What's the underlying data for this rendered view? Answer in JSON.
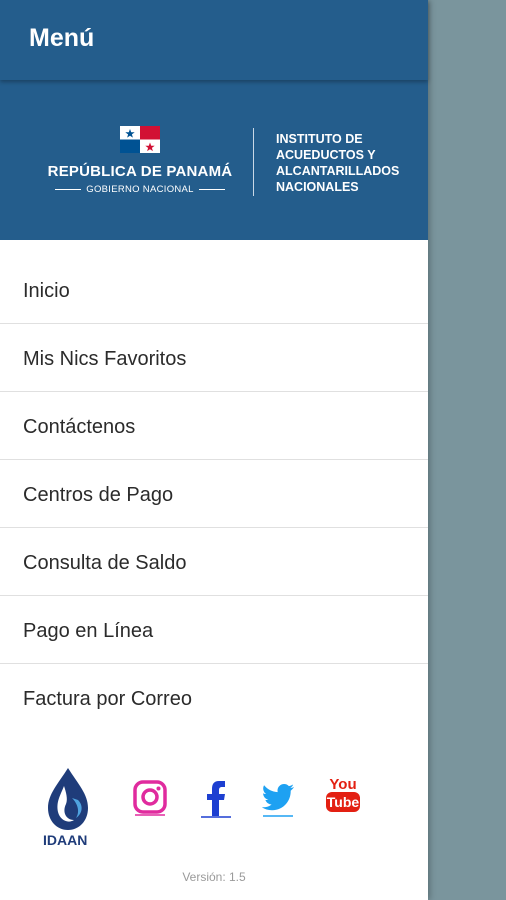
{
  "appbar": {
    "title": "Menú"
  },
  "banner": {
    "country": "REPÚBLICA DE PANAMÁ",
    "government": "GOBIERNO NACIONAL",
    "institute_lines": [
      "INSTITUTO DE",
      "ACUEDUCTOS Y",
      "ALCANTARILLADOS",
      "NACIONALES"
    ]
  },
  "menu": {
    "items": [
      {
        "label": "Inicio"
      },
      {
        "label": "Mis Nics Favoritos"
      },
      {
        "label": "Contáctenos"
      },
      {
        "label": "Centros de Pago"
      },
      {
        "label": "Consulta de Saldo"
      },
      {
        "label": "Pago en Línea"
      },
      {
        "label": "Factura por Correo"
      }
    ]
  },
  "footer": {
    "logo_text": "IDAAN",
    "social_icons": [
      "instagram-icon",
      "facebook-icon",
      "twitter-icon",
      "youtube-icon"
    ],
    "youtube_top": "You",
    "youtube_bottom": "Tube",
    "version": "Versión: 1.5"
  },
  "colors": {
    "primary": "#245d8c",
    "scrim": "#7a959d",
    "instagram": "#e02b9e",
    "facebook": "#1d3fd1",
    "twitter": "#1ea1f2",
    "youtube": "#e32012"
  }
}
